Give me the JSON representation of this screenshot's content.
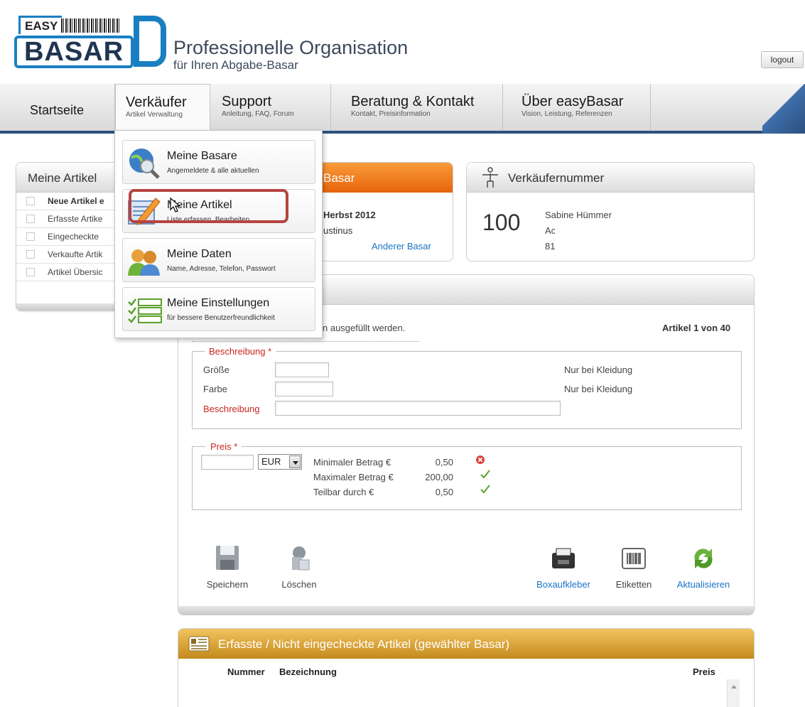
{
  "header": {
    "logo_top": "EASY",
    "logo_bottom": "BASAR",
    "title": "Professionelle Organisation",
    "subtitle": "für Ihren Abgabe-Basar",
    "logout_label": "logout"
  },
  "nav": {
    "items": [
      {
        "label": "Startseite",
        "sub": ""
      },
      {
        "label": "Verkäufer",
        "sub": "Artikel Verwaltung"
      },
      {
        "label": "Support",
        "sub": "Anleitung, FAQ, Forum"
      },
      {
        "label": "Beratung & Kontakt",
        "sub": "Kontakt, Preisinformation"
      },
      {
        "label": "Über easyBasar",
        "sub": "Vision, Leistung, Referenzen"
      }
    ]
  },
  "dropdown": {
    "items": [
      {
        "label": "Meine Basare",
        "sub": "Angemeldete & alle aktuellen",
        "icon": "globe-search-icon"
      },
      {
        "label": "Meine Artikel",
        "sub": "Liste erfassen, Bearbeiten",
        "icon": "pencil-document-icon"
      },
      {
        "label": "Meine Daten",
        "sub": "Name, Adresse, Telefon, Passwort",
        "icon": "users-icon"
      },
      {
        "label": "Meine Einstellungen",
        "sub": "für bessere Benutzerfreundlichkeit",
        "icon": "checklist-icon"
      }
    ]
  },
  "left_panel": {
    "title": "Meine Artikel",
    "items": [
      "Neue Artikel e",
      "Erfasste Artike",
      "Eingecheckte",
      "Verkaufte Artik",
      "Artikel Übersic"
    ]
  },
  "basar_panel": {
    "title": "Basar",
    "line1": "Herbst 2012",
    "line2": "ustinus",
    "link": "Anderer Basar"
  },
  "seller_panel": {
    "title": "Verkäufernummer",
    "number": "100",
    "name": "Sabine Hümmer",
    "addr1": "Ac",
    "addr2": "81"
  },
  "form": {
    "hint": "n ausgefüllt werden.",
    "counter": "Artikel 1 von 40",
    "desc_legend": "Beschreibung *",
    "size_label": "Größe",
    "color_label": "Farbe",
    "desc_label": "Beschreibung",
    "size_value": "",
    "color_value": "",
    "desc_value": "",
    "clothing_note_1": "Nur bei Kleidung",
    "clothing_note_2": "Nur bei Kleidung",
    "price_legend": "Preis *",
    "price_value": "",
    "currency": "EUR",
    "min_label": "Minimaler Betrag €",
    "min_value": "0,50",
    "min_status": "error",
    "max_label": "Maximaler Betrag €",
    "max_value": "200,00",
    "max_status": "ok",
    "div_label": "Teilbar durch €",
    "div_value": "0,50",
    "div_status": "ok"
  },
  "actions": {
    "save": "Speichern",
    "delete": "Löschen",
    "box_label": "Boxaufkleber",
    "labels": "Etiketten",
    "refresh": "Aktualisieren"
  },
  "list_panel": {
    "title": "Erfasste / Nicht eingecheckte Artikel (gewählter Basar)",
    "col_number": "Nummer",
    "col_desc": "Bezeichnung",
    "col_price": "Preis"
  },
  "colors": {
    "nav_accent": "#2c4f7e",
    "highlight": "#b5443f",
    "basar_orange": "#e8640a",
    "list_gold": "#c48a1c",
    "required_red": "#c9261f",
    "link_blue": "#1a73c5",
    "ok_green": "#5aa02c"
  }
}
